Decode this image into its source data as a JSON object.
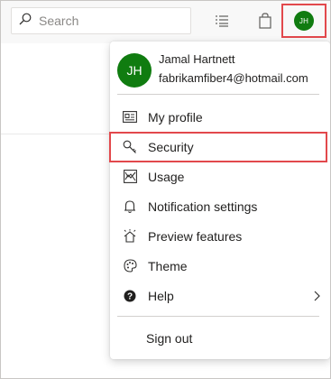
{
  "search": {
    "placeholder": "Search"
  },
  "header": {
    "avatar_initials": "JH",
    "icons": {
      "search": "search-icon",
      "list": "list-settings-icon",
      "bag": "shopping-bag-icon"
    }
  },
  "user": {
    "initials": "JH",
    "name": "Jamal Hartnett",
    "email": "fabrikamfiber4@hotmail.com",
    "avatar_color": "#107c10"
  },
  "menu": {
    "items": [
      {
        "label": "My profile",
        "icon": "id-card-icon"
      },
      {
        "label": "Security",
        "icon": "key-icon"
      },
      {
        "label": "Usage",
        "icon": "chart-icon"
      },
      {
        "label": "Notification settings",
        "icon": "bell-icon"
      },
      {
        "label": "Preview features",
        "icon": "preview-icon"
      },
      {
        "label": "Theme",
        "icon": "palette-icon"
      },
      {
        "label": "Help",
        "icon": "help-icon",
        "has_submenu": true
      }
    ],
    "sign_out": "Sign out"
  },
  "colors": {
    "highlight": "#e2484c",
    "avatar": "#107c10"
  }
}
